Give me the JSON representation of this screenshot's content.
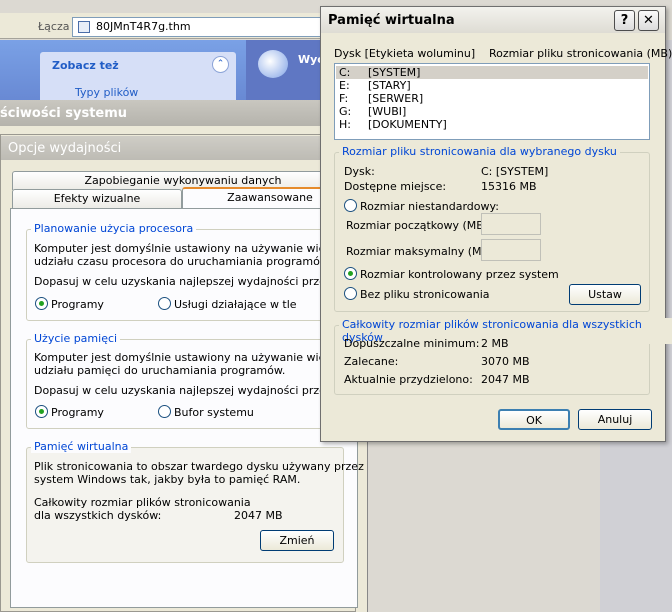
{
  "explorer": {
    "address_label": "Łącza",
    "address_value": "80JMnT4R7g.thm",
    "see_also_title": "Zobacz też",
    "see_also_item": "Typy plików",
    "right_title": "Wyc"
  },
  "system_properties": {
    "title": "ściwości systemu"
  },
  "performance_options": {
    "title": "Opcje wydajności",
    "tabs": [
      "Zapobieganie wykonywaniu danych",
      "Efekty wizualne",
      "Zaawansowane"
    ],
    "processor": {
      "legend": "Planowanie użycia procesora",
      "desc_line1": "Komputer jest domyślnie ustawiony na używanie większego",
      "desc_line2": "udziału czasu procesora do uruchamiania programów.",
      "adjust": "Dopasuj w celu uzyskania najlepszej wydajności przez:",
      "opt_programs": "Programy",
      "opt_background": "Usługi działające w tle"
    },
    "memory": {
      "legend": "Użycie pamięci",
      "desc_line1": "Komputer jest domyślnie ustawiony na używanie większego",
      "desc_line2": "udziału pamięci do uruchamiania programów.",
      "adjust": "Dopasuj w celu uzyskania najlepszej wydajności przez:",
      "opt_programs": "Programy",
      "opt_cache": "Bufor systemu"
    },
    "virtual": {
      "legend": "Pamięć wirtualna",
      "desc_line1": "Plik stronicowania to obszar twardego dysku używany przez",
      "desc_line2": "system Windows tak, jakby była to pamięć RAM.",
      "total_line1": "Całkowity rozmiar plików stronicowania",
      "total_line2": "dla wszystkich dysków:",
      "total_value": "2047 MB",
      "change_button": "Zmień"
    }
  },
  "virtual_memory": {
    "title": "Pamięć wirtualna",
    "help_symbol": "?",
    "close_symbol": "✕",
    "col_drive": "Dysk [Etykieta woluminu]",
    "col_size": "Rozmiar pliku stronicowania (MB)",
    "drives": [
      {
        "letter": "C:",
        "label": "[SYSTEM]"
      },
      {
        "letter": "E:",
        "label": "[STARY]"
      },
      {
        "letter": "F:",
        "label": "[SERWER]"
      },
      {
        "letter": "G:",
        "label": "[WUBI]"
      },
      {
        "letter": "H:",
        "label": "[DOKUMENTY]"
      }
    ],
    "selected": {
      "legend": "Rozmiar pliku stronicowania dla wybranego dysku",
      "drive_label": "Dysk:",
      "drive_value": "C: [SYSTEM]",
      "space_label": "Dostępne miejsce:",
      "space_value": "15316 MB",
      "opt_custom": "Rozmiar niestandardowy:",
      "initial_label": "Rozmiar początkowy (MB):",
      "max_label": "Rozmiar maksymalny (MB):",
      "opt_system": "Rozmiar kontrolowany przez system",
      "opt_none": "Bez pliku stronicowania",
      "set_button": "Ustaw"
    },
    "total": {
      "legend": "Całkowity rozmiar plików stronicowania dla wszystkich dysków",
      "min_label": "Dopuszczalne minimum:",
      "min_value": "2 MB",
      "rec_label": "Zalecane:",
      "rec_value": "3070 MB",
      "cur_label": "Aktualnie przydzielono:",
      "cur_value": "2047 MB"
    },
    "ok_button": "OK",
    "cancel_button": "Anuluj"
  }
}
